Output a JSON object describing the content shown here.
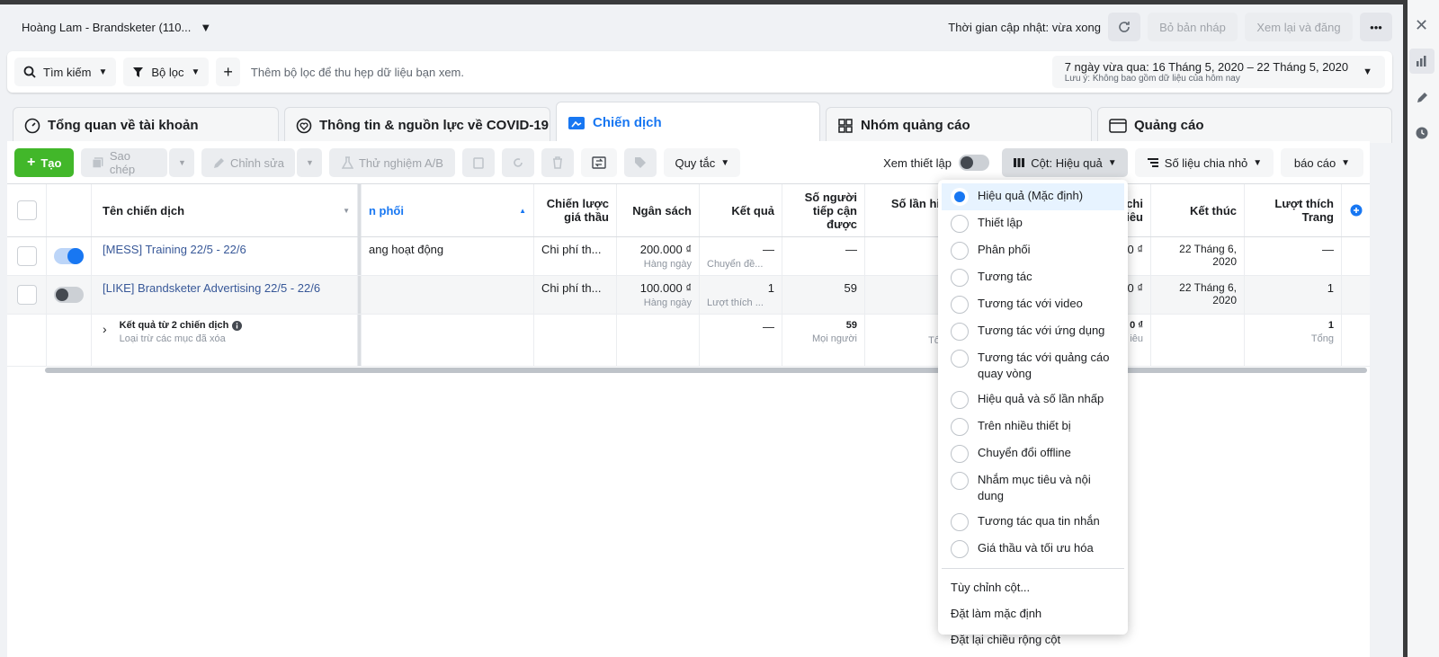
{
  "account": {
    "name": "Hoàng Lam - Brandsketer (110..."
  },
  "header": {
    "update_time": "Thời gian cập nhật: vừa xong",
    "discard_draft": "Bỏ bản nháp",
    "review_publish": "Xem lại và đăng"
  },
  "filterbar": {
    "search": "Tìm kiếm",
    "filter": "Bộ lọc",
    "add_placeholder": "Thêm bộ lọc để thu hẹp dữ liệu bạn xem.",
    "date_range": "7 ngày vừa qua: 16 Tháng 5, 2020 – 22 Tháng 5, 2020",
    "date_note": "Lưu ý: Không bao gồm dữ liệu của hôm nay"
  },
  "tabs": [
    {
      "label": "Tổng quan về tài khoản"
    },
    {
      "label": "Thông tin & nguồn lực về COVID-19"
    },
    {
      "label": "Chiến dịch"
    },
    {
      "label": "Nhóm quảng cáo"
    },
    {
      "label": "Quảng cáo"
    }
  ],
  "toolbar": {
    "create": "Tạo",
    "duplicate": "Sao chép",
    "edit": "Chỉnh sửa",
    "ab_test": "Thử nghiệm A/B",
    "rules": "Quy tắc",
    "view_setup": "Xem thiết lập",
    "columns": "Cột: Hiệu quả",
    "breakdown": "Số liệu chia nhỏ",
    "reports": "báo cáo"
  },
  "table": {
    "headers": {
      "name": "Tên chiến dịch",
      "delivery": "n phối",
      "bid_strategy": "Chiến lược giá thầu",
      "budget": "Ngân sách",
      "results": "Kết quả",
      "reach": "Số người tiếp cận được",
      "impressions": "Số lần hi",
      "cost_partial": "chi iêu",
      "ends": "Kết thúc",
      "page_likes": "Lượt thích Trang"
    },
    "rows": [
      {
        "name": "[MESS] Training 22/5 - 22/6",
        "delivery": "ang hoạt động",
        "bid": "Chi phí th...",
        "budget": "200.000 ₫",
        "budget_sub": "Hàng ngày",
        "results": "—",
        "results_sub": "Chuyển đề...",
        "reach": "—",
        "cost": "0 ₫",
        "ends": "22 Tháng 6, 2020",
        "likes": "—",
        "active": true
      },
      {
        "name": "[LIKE] Brandsketer Advertising 22/5 - 22/6",
        "delivery": "",
        "bid": "Chi phí th...",
        "budget": "100.000 ₫",
        "budget_sub": "Hàng ngày",
        "results": "1",
        "results_sub": "Lượt thích ...",
        "reach": "59",
        "cost": "0 ₫",
        "ends": "22 Tháng 6, 2020",
        "likes": "1",
        "active": false
      }
    ],
    "summary": {
      "title": "Kết quả từ 2 chiến dịch",
      "sub": "Loại trừ các mục đã xóa",
      "results": "—",
      "reach": "59",
      "reach_sub": "Mọi người",
      "impr_partial": "Tổ",
      "cost": "0 ₫",
      "cost_sub": "iêu",
      "likes": "1",
      "likes_sub": "Tổng"
    }
  },
  "column_menu": {
    "presets": [
      {
        "label": "Hiệu quả (Mặc định)",
        "selected": true
      },
      {
        "label": "Thiết lập",
        "selected": false
      },
      {
        "label": "Phân phối",
        "selected": false
      },
      {
        "label": "Tương tác",
        "selected": false
      },
      {
        "label": "Tương tác với video",
        "selected": false
      },
      {
        "label": "Tương tác với ứng dụng",
        "selected": false
      },
      {
        "label": "Tương tác với quảng cáo quay vòng",
        "selected": false
      },
      {
        "label": "Hiệu quả và số lần nhấp",
        "selected": false
      },
      {
        "label": "Trên nhiều thiết bị",
        "selected": false
      },
      {
        "label": "Chuyển đổi offline",
        "selected": false
      },
      {
        "label": "Nhắm mục tiêu và nội dung",
        "selected": false
      },
      {
        "label": "Tương tác qua tin nhắn",
        "selected": false
      },
      {
        "label": "Giá thầu và tối ưu hóa",
        "selected": false
      }
    ],
    "actions": [
      "Tùy chỉnh cột...",
      "Đặt làm mặc định",
      "Đặt lại chiều rộng cột"
    ]
  },
  "colors": {
    "accent": "#1877f2",
    "create_green": "#42b72a",
    "link": "#385898"
  }
}
